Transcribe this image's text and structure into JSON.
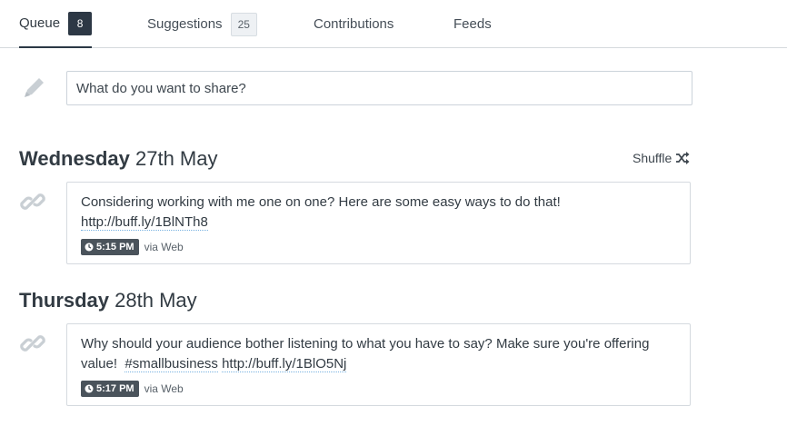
{
  "tabs": [
    {
      "label": "Queue",
      "count": "8"
    },
    {
      "label": "Suggestions",
      "count": "25"
    },
    {
      "label": "Contributions"
    },
    {
      "label": "Feeds"
    }
  ],
  "composer": {
    "placeholder": "What do you want to share?"
  },
  "shuffle_label": "Shuffle",
  "days": [
    {
      "weekday": "Wednesday",
      "date": "27th May",
      "post": {
        "text": "Considering working with me one on one? Here are some easy ways to do that!",
        "link": "http://buff.ly/1BlNTh8",
        "time": "5:15 PM",
        "via": "via Web"
      }
    },
    {
      "weekday": "Thursday",
      "date": "28th May",
      "post": {
        "text": "Why should your audience bother listening to what you have to say? Make sure you're offering value!",
        "hashtag": "#smallbusiness",
        "link": "http://buff.ly/1BlO5Nj",
        "time": "5:17 PM",
        "via": "via Web"
      }
    }
  ],
  "icons": [
    "pencil-icon",
    "link-icon",
    "shuffle-icon",
    "clock-icon"
  ]
}
